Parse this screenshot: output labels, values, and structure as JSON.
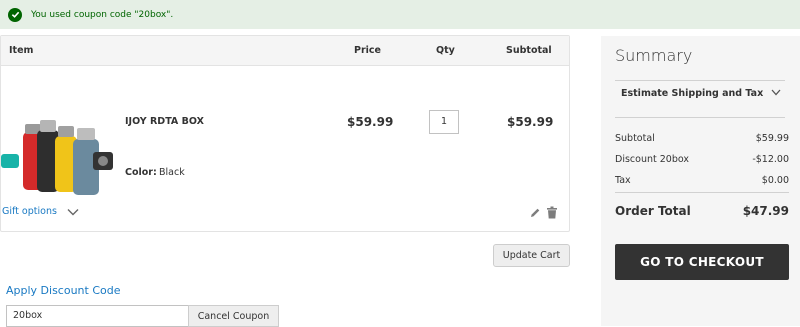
{
  "notice": {
    "message": "You used coupon code \"20box\"."
  },
  "cart": {
    "headers": {
      "item": "Item",
      "price": "Price",
      "qty": "Qty",
      "subtotal": "Subtotal"
    },
    "item": {
      "name": "IJOY RDTA BOX",
      "option_label": "Color:",
      "option_value": "Black",
      "price": "$59.99",
      "qty": "1",
      "subtotal": "$59.99"
    },
    "gift_options": "Gift options",
    "update_button": "Update Cart"
  },
  "discount": {
    "title": "Apply Discount Code",
    "code": "20box",
    "cancel_button": "Cancel Coupon"
  },
  "summary": {
    "title": "Summary",
    "estimate": "Estimate Shipping and Tax",
    "rows": [
      {
        "label": "Subtotal",
        "value": "$59.99"
      },
      {
        "label": "Discount 20box",
        "value": "-$12.00"
      },
      {
        "label": "Tax",
        "value": "$0.00"
      }
    ],
    "order_total_label": "Order Total",
    "order_total_value": "$47.99",
    "checkout_button": "GO TO CHECKOUT"
  },
  "colors": {
    "success_bg": "#e5efe5",
    "success_text": "#006400",
    "link": "#1979c3",
    "checkout_bg": "#333333"
  },
  "icons": [
    "check-icon",
    "chevron-down-icon",
    "edit-icon",
    "trash-icon"
  ]
}
